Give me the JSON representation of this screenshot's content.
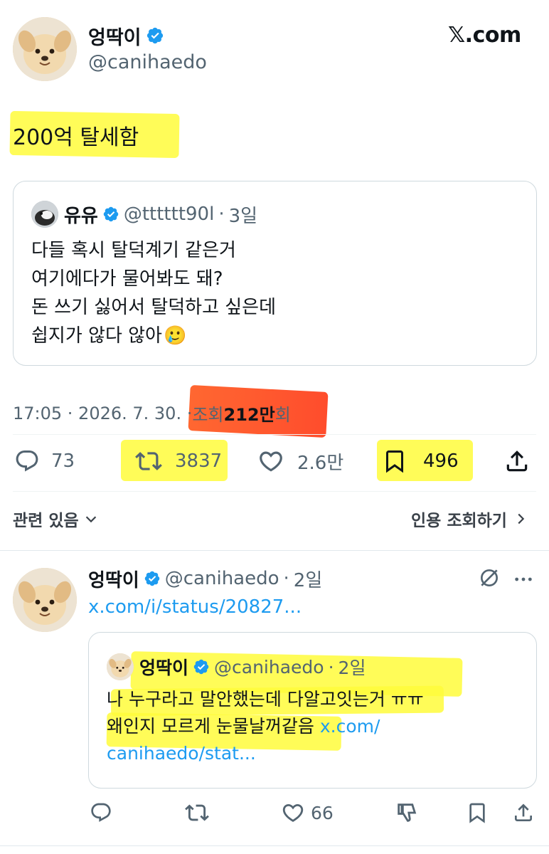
{
  "header": {
    "display_name": "엉딱이",
    "handle": "@canihaedo",
    "site_logo_text": "𝕏.com"
  },
  "tweet": {
    "text": "200억 탈세함",
    "quote": {
      "display_name": "유유",
      "handle": "@tttttt90l",
      "dot": "·",
      "time": "3일",
      "lines": [
        "다들 혹시 탈덕계기 같은거",
        "여기에다가 물어봐도 돼?",
        "돈 쓰기 싫어서 탈덕하고 싶은데",
        "쉽지가 않다 않아"
      ],
      "emoji": "🥲"
    },
    "meta": {
      "time_date": "17:05 · 2026. 7. 30. · ",
      "views_prefix": "조회 ",
      "views_count": "212만",
      "views_suffix": "회"
    },
    "actions": {
      "replies": "73",
      "retweets": "3837",
      "likes": "2.6만",
      "bookmarks": "496"
    },
    "related_label": "관련 있음",
    "quote_views_label": "인용 조회하기"
  },
  "reply": {
    "display_name": "엉딱이",
    "handle": "@canihaedo",
    "dot": "·",
    "time": "2일",
    "link_text": "x.com/i/status/20827...",
    "quote": {
      "display_name": "엉딱이",
      "handle": "@canihaedo",
      "dot": "·",
      "time": "2일",
      "line1": "나 누구라고 말안했는데 다알고잇는거 ㅠㅠ",
      "line2": "왜인지 모르게 눈물날꺼같음 ",
      "link1": "x.com/",
      "link2": "canihaedo/stat..."
    },
    "actions": {
      "likes": "66"
    }
  },
  "colors": {
    "highlight": "#fffb3b",
    "highlight_red": "#ff4a1c",
    "link": "#1d9bf0",
    "secondary": "#536471",
    "verified": "#1d9bf0"
  }
}
